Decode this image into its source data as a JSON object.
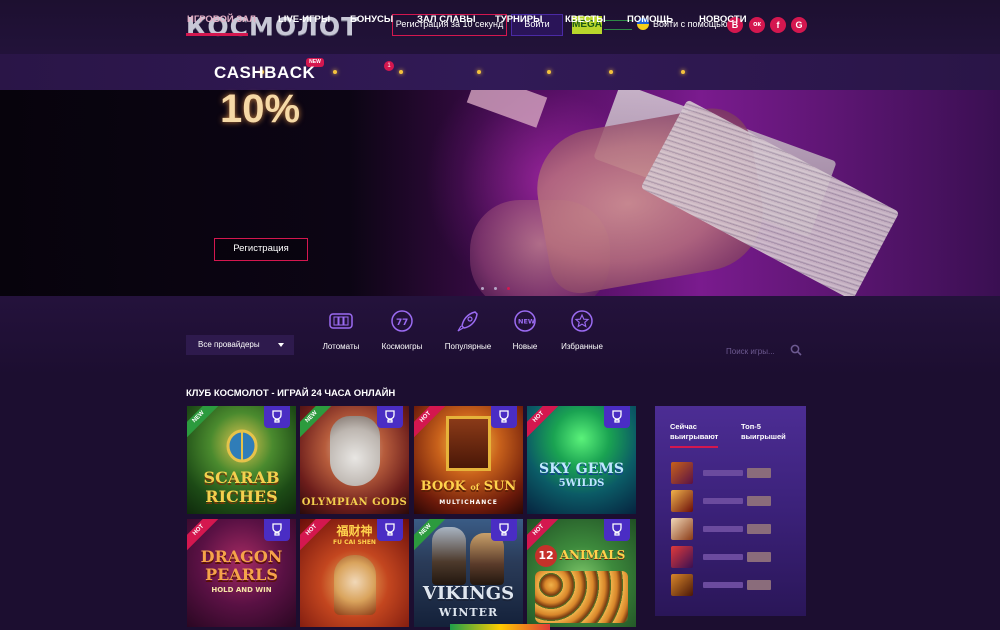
{
  "header": {
    "logo": "КОСМОЛОТ",
    "register_label": "Регистрация за 10 секунд",
    "login_label": "Войти",
    "mega_badge": "MEGA",
    "login_with": "Войти с помощью:",
    "socials": [
      {
        "name": "vk",
        "glyph": "B"
      },
      {
        "name": "ok",
        "glyph": "ок"
      },
      {
        "name": "facebook",
        "glyph": "f"
      },
      {
        "name": "google",
        "glyph": "G"
      }
    ]
  },
  "nav": {
    "items": [
      "ИГРОВОЙ ЗАЛ",
      "LIVE-ИГРЫ",
      "БОНУСЫ",
      "ЗАЛ СЛАВЫ",
      "ТУРНИРЫ",
      "КВЕСТЫ",
      "ПОМОЩЬ",
      "НОВОСТИ"
    ],
    "active_index": 0,
    "new_badge": "NEW",
    "bonus_count": "1"
  },
  "hero": {
    "title": "CASHBACK",
    "value": "10%",
    "button_label": "Регистрация",
    "slides": 3,
    "active_slide": 2
  },
  "filters": {
    "provider_select": "Все провайдеры",
    "categories": [
      "Лотоматы",
      "Космоигры",
      "Популярные",
      "Новые",
      "Избранные"
    ],
    "search_placeholder": "Поиск игры..."
  },
  "section": {
    "title": "КЛУБ КОСМОЛОТ - ИГРАЙ 24 ЧАСА ОНЛАЙН"
  },
  "games": [
    {
      "name": "SCARAB RICHES",
      "tag": "NEW",
      "line1": "SCARAB",
      "line2": "RICHES",
      "line3": ""
    },
    {
      "name": "OLYMPIAN GODS",
      "tag": "NEW",
      "line1": "OLYMPIAN",
      "line2": "GODS",
      "line3": ""
    },
    {
      "name": "BOOK OF SUN",
      "tag": "HOT",
      "line1": "BOOK",
      "line2": "SUN",
      "line3": "MULTICHANCE"
    },
    {
      "name": "SKY GEMS 5 WILDS",
      "tag": "HOT",
      "line1": "SKY GEMS",
      "line2": "5WILDS",
      "line3": ""
    },
    {
      "name": "DRAGON PEARLS",
      "tag": "HOT",
      "line1": "DRAGON",
      "line2": "PEARLS",
      "line3": "HOLD AND WIN"
    },
    {
      "name": "FU CAI SHEN",
      "tag": "HOT",
      "line1": "福财神",
      "line2": "FU CAI SHEN",
      "line3": ""
    },
    {
      "name": "VIKINGS WINTER",
      "tag": "NEW",
      "line1": "VIKINGS",
      "line2": "WINTER",
      "line3": ""
    },
    {
      "name": "12 ANIMALS",
      "tag": "HOT",
      "line1": "12",
      "line2": "ANIMALS",
      "line3": ""
    }
  ],
  "winners": {
    "tab_now": "Сейчас выигрывают",
    "tab_top": "Топ-5 выигрышей"
  },
  "colors": {
    "accent": "#d4174f",
    "nav_bg": "#2a1547",
    "page_bg": "#1b0d2b"
  }
}
